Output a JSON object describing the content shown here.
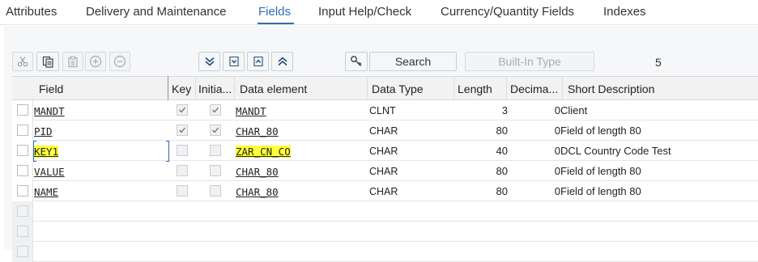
{
  "tabs": [
    {
      "label": "Attributes",
      "active": false
    },
    {
      "label": "Delivery and Maintenance",
      "active": false
    },
    {
      "label": "Fields",
      "active": true
    },
    {
      "label": "Input Help/Check",
      "active": false
    },
    {
      "label": "Currency/Quantity Fields",
      "active": false
    },
    {
      "label": "Indexes",
      "active": false
    }
  ],
  "toolbar": {
    "icons": [
      "cut-icon",
      "copy-icon",
      "paste-icon",
      "insert-row-icon",
      "delete-row-icon",
      "scroll-bottom-icon",
      "scroll-down-icon",
      "scroll-up-icon",
      "scroll-top-icon",
      "search-key-icon"
    ],
    "search_label": "Search",
    "builtin_type_label": "Built-In Type",
    "field_count": "5"
  },
  "table": {
    "columns": [
      "Field",
      "Key",
      "Initia...",
      "Data element",
      "Data Type",
      "Length",
      "Decima...",
      "Short Description"
    ],
    "rows": [
      {
        "field": "MANDT",
        "key": true,
        "initial": true,
        "data_element": "MANDT",
        "data_type": "CLNT",
        "length": "3",
        "decimals": "0",
        "description": "Client",
        "highlight": false
      },
      {
        "field": "PID",
        "key": true,
        "initial": true,
        "data_element": "CHAR_80",
        "data_type": "CHAR",
        "length": "80",
        "decimals": "0",
        "description": "Field of  length 80",
        "highlight": false
      },
      {
        "field": "KEY1",
        "key": false,
        "initial": false,
        "data_element": "ZAR_CN_CO",
        "data_type": "CHAR",
        "length": "40",
        "decimals": "0",
        "description": "DCL Country Code Test",
        "highlight": true
      },
      {
        "field": "VALUE",
        "key": false,
        "initial": false,
        "data_element": "CHAR_80",
        "data_type": "CHAR",
        "length": "80",
        "decimals": "0",
        "description": "Field of  length 80",
        "highlight": false
      },
      {
        "field": "NAME",
        "key": false,
        "initial": false,
        "data_element": "CHAR_80",
        "data_type": "CHAR",
        "length": "80",
        "decimals": "0",
        "description": "Field of  length 80",
        "highlight": false
      }
    ],
    "empty_rows": 3
  },
  "colors": {
    "accent": "#2f6eb5",
    "highlight": "#ffff3a"
  }
}
